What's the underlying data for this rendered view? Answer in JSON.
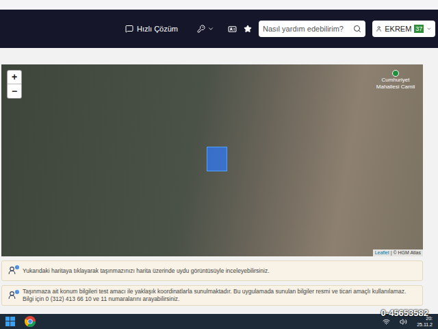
{
  "header": {
    "quick_solution": {
      "label": "Hızlı Çözüm"
    },
    "search": {
      "placeholder": "Nasıl yardım edebilirim?"
    },
    "user": {
      "name": "EKREM",
      "badge": "37"
    }
  },
  "map": {
    "zoom_in": "+",
    "zoom_out": "−",
    "poi_label": "Cumhuriyet Mahallesi Camii",
    "attribution_link": "Leaflet",
    "attribution": "| © HGM Atlas",
    "parcel_selected": true
  },
  "notices": [
    {
      "text": "Yukarıdaki haritaya tıklayarak taşınmazınızı harita üzerinde uydu görüntüsüyle inceleyebilirsiniz."
    },
    {
      "text": "Taşınmaza ait konum bilgileri test amacı ile yaklaşık koordinatlarla sunulmaktadır. Bu uygulamada sunulan bilgiler resmi ve ticari amaçlı kullanılamaz. Bilgi için 0 (312) 413 66 10 ve 11 numaralarını arayabilirsiniz."
    }
  ],
  "taskbar": {
    "time": "20:",
    "date": "25.11.2"
  },
  "watermark": "0-45653582"
}
